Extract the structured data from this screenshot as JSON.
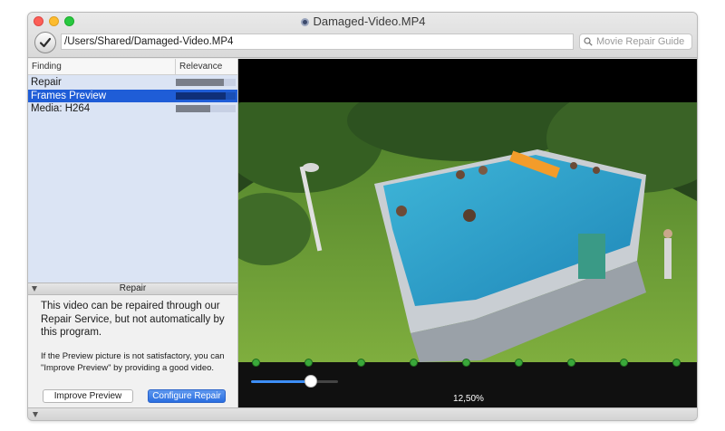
{
  "window": {
    "title": "Damaged-Video.MP4"
  },
  "toolbar": {
    "path": "/Users/Shared/Damaged-Video.MP4",
    "search_placeholder": "Movie Repair Guide"
  },
  "findings": {
    "columns": {
      "finding": "Finding",
      "relevance": "Relevance"
    },
    "rows": [
      {
        "label": "Repair",
        "relevance": 0.8,
        "selected": false
      },
      {
        "label": "Frames Preview",
        "relevance": 0.84,
        "selected": true
      },
      {
        "label": "Media: H264",
        "relevance": 0.58,
        "selected": false
      }
    ]
  },
  "repair": {
    "header": "Repair",
    "description": "This video can be repaired through our Repair Service, but not automatically by this program.",
    "note": "If the Preview picture is not satisfactory, you can \"Improve Preview\" by providing a good video.",
    "improve_label": "Improve Preview",
    "configure_label": "Configure Repair"
  },
  "preview": {
    "zoom": "12,50%",
    "frame_marker_count": 9,
    "slider_level": 0.69
  },
  "colors": {
    "selection": "#1f5dd7",
    "accent": "#3d8ef5",
    "marker": "#3aa83a"
  }
}
